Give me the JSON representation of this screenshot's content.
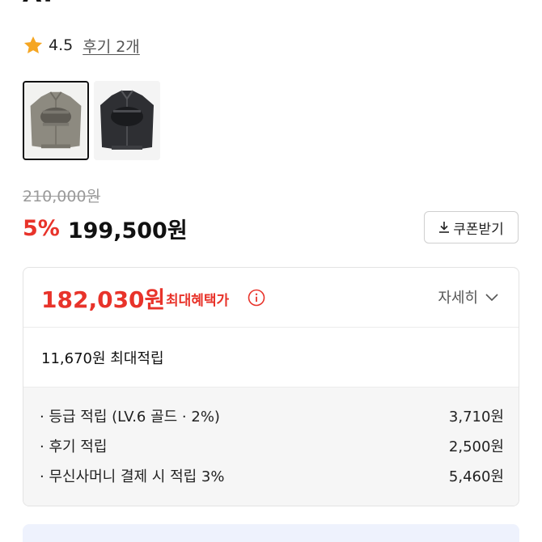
{
  "product": {
    "title_cut": "AT"
  },
  "rating": {
    "value": "4.5",
    "review_link": "후기 2개"
  },
  "thumbnails": [
    {
      "name": "jacket-gray",
      "selected": true,
      "color": "#8d8a80"
    },
    {
      "name": "jacket-black",
      "selected": false,
      "color": "#2e2f33"
    }
  ],
  "pricing": {
    "original_price": "210,000원",
    "discount_rate": "5%",
    "sale_price": "199,500원",
    "coupon_label": "쿠폰받기"
  },
  "benefits": {
    "max_benefit_price": "182,030원",
    "max_benefit_label": "최대혜택가",
    "detail_label": "자세히",
    "max_points": "11,670원 최대적립",
    "items": [
      {
        "label": "· 등급 적립 (LV.6 골드 · 2%)",
        "value": "3,710원"
      },
      {
        "label": "· 후기 적립",
        "value": "2,500원"
      },
      {
        "label": "· 무신사머니 결제 시 적립 3%",
        "value": "5,460원"
      }
    ]
  },
  "colors": {
    "accent_red": "#e8332a",
    "banner_bg": "#eef2fd"
  },
  "icons": [
    "star-icon",
    "info-icon",
    "download-icon",
    "chevron-down-icon"
  ]
}
